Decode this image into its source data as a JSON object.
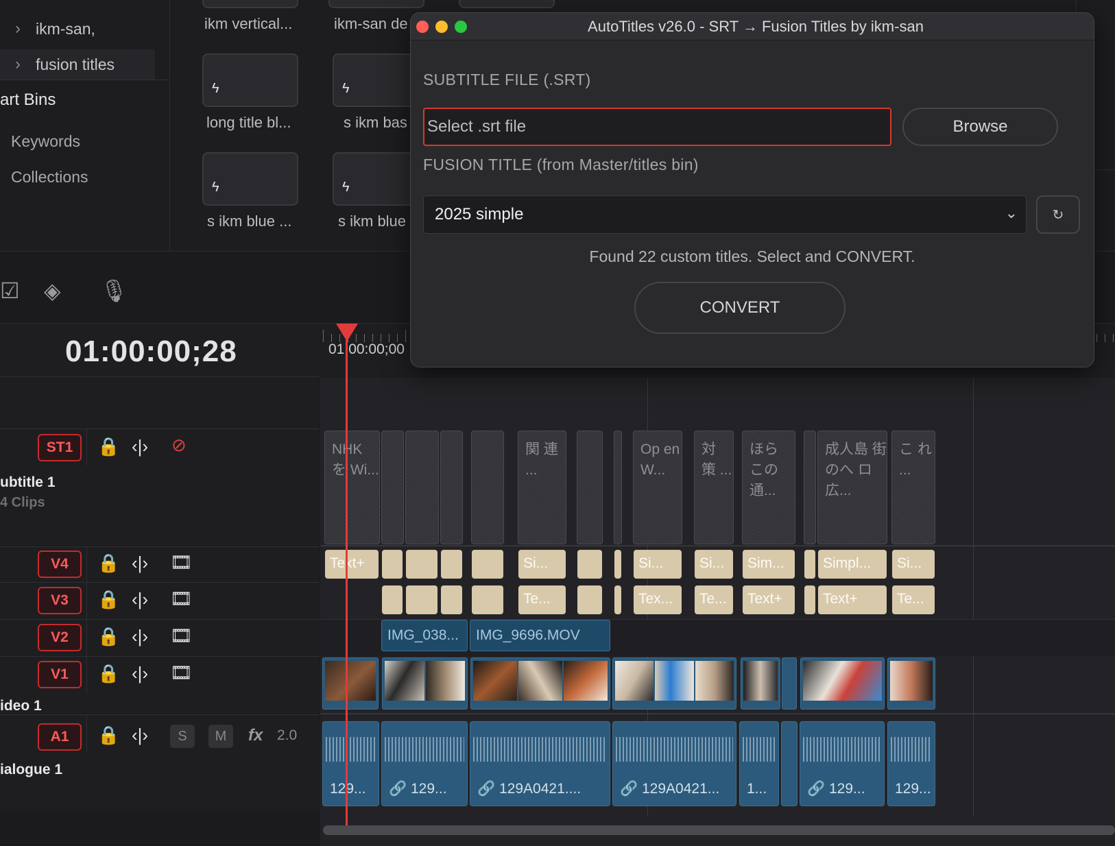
{
  "bins": {
    "items": [
      {
        "label": "ikm-san,"
      },
      {
        "label": "fusion titles"
      }
    ],
    "section_title": "art Bins",
    "links": [
      "Keywords",
      "Collections"
    ]
  },
  "thumbs": [
    {
      "label": "ikm vertical..."
    },
    {
      "label": "ikm-san de"
    },
    {
      "label": "long title bl..."
    },
    {
      "label": "s ikm bas"
    },
    {
      "label": "s ikm blue ..."
    },
    {
      "label": "s ikm blue"
    }
  ],
  "timeline": {
    "timecode": "01:00:00;28",
    "ruler_timecode": "01:00:00;00",
    "tracks": {
      "st1": {
        "badge": "ST1",
        "name": "ubtitle 1",
        "sub": "4 Clips"
      },
      "v4": {
        "badge": "V4"
      },
      "v3": {
        "badge": "V3"
      },
      "v2": {
        "badge": "V2"
      },
      "v1": {
        "badge": "V1",
        "name": "ideo 1"
      },
      "a1": {
        "badge": "A1",
        "name": "ialogue 1",
        "solo": "S",
        "mute": "M",
        "fx": "fx",
        "volume": "2.0"
      }
    },
    "subtitle_clips": [
      "NHK を Wi...",
      "",
      "",
      "",
      "",
      "関 連 ...",
      "",
      "",
      "Op en W...",
      "対 策 ...",
      "ほら この 通...",
      "",
      "成人島 街のへ ロ広...",
      "こ れ ..."
    ],
    "v4_clips": [
      "Text+",
      "",
      "",
      "",
      "",
      "Si...",
      "",
      "",
      "Si...",
      "Si...",
      "Sim...",
      "",
      "Simpl...",
      "Si..."
    ],
    "v3_clips": [
      "",
      "",
      "",
      "",
      "Te...",
      "",
      "",
      "Tex...",
      "Te...",
      "Text+",
      "",
      "Text+",
      "Te..."
    ],
    "v2_clips": [
      "IMG_038...",
      "IMG_9696.MOV"
    ],
    "a1_clips": [
      "129...",
      "129...",
      "129A0421....",
      "129A0421...",
      "1...",
      "",
      "129...",
      "129..."
    ]
  },
  "dialog": {
    "title": "AutoTitles v26.0 - SRT → Fusion Titles by ikm-san",
    "subtitle_label": "SUBTITLE FILE (.SRT)",
    "srt_placeholder": "Select .srt file",
    "browse_label": "Browse",
    "fusion_label": "FUSION TITLE (from Master/titles bin)",
    "selected_title": "2025 simple",
    "refresh_label": "↻",
    "status": "Found 22 custom titles. Select and CONVERT.",
    "convert_label": "CONVERT"
  },
  "colors": {
    "accent_red": "#e23b3b",
    "clip_blue": "#2b5878",
    "title_clip": "#d8c9aa",
    "traffic_close": "#ff5f57",
    "traffic_min": "#febc2e",
    "traffic_max": "#28c840"
  }
}
